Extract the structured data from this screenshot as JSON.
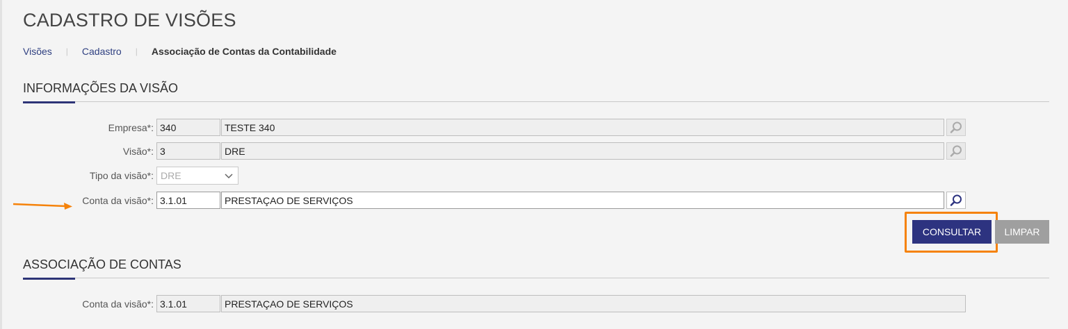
{
  "page": {
    "title": "CADASTRO DE VISÕES"
  },
  "breadcrumb": {
    "items": [
      "Visões",
      "Cadastro"
    ],
    "current": "Associação de Contas da Contabilidade"
  },
  "info_section": {
    "title": "INFORMAÇÕES DA VISÃO",
    "empresa": {
      "label": "Empresa*:",
      "code": "340",
      "description": "TESTE 340"
    },
    "visao": {
      "label": "Visão*:",
      "code": "3",
      "description": "DRE"
    },
    "tipo_visao": {
      "label": "Tipo da visão*:",
      "selected": "DRE"
    },
    "conta_visao": {
      "label": "Conta da visão*:",
      "code": "3.1.01",
      "description": "PRESTAÇAO DE SERVIÇOS"
    }
  },
  "actions": {
    "consultar": "CONSULTAR",
    "limpar": "LIMPAR"
  },
  "assoc_section": {
    "title": "ASSOCIAÇÃO DE CONTAS",
    "conta_visao": {
      "label": "Conta da visão*:",
      "code": "3.1.01",
      "description": "PRESTAÇAO DE SERVIÇOS"
    }
  },
  "colors": {
    "primary": "#2d3380",
    "accent_orange": "#f5820a",
    "secondary_button": "#9f9f9f"
  },
  "icons": {
    "lookup": "magnifier-icon",
    "select": "chevron-down-icon",
    "annotation": "arrow-right-icon"
  }
}
